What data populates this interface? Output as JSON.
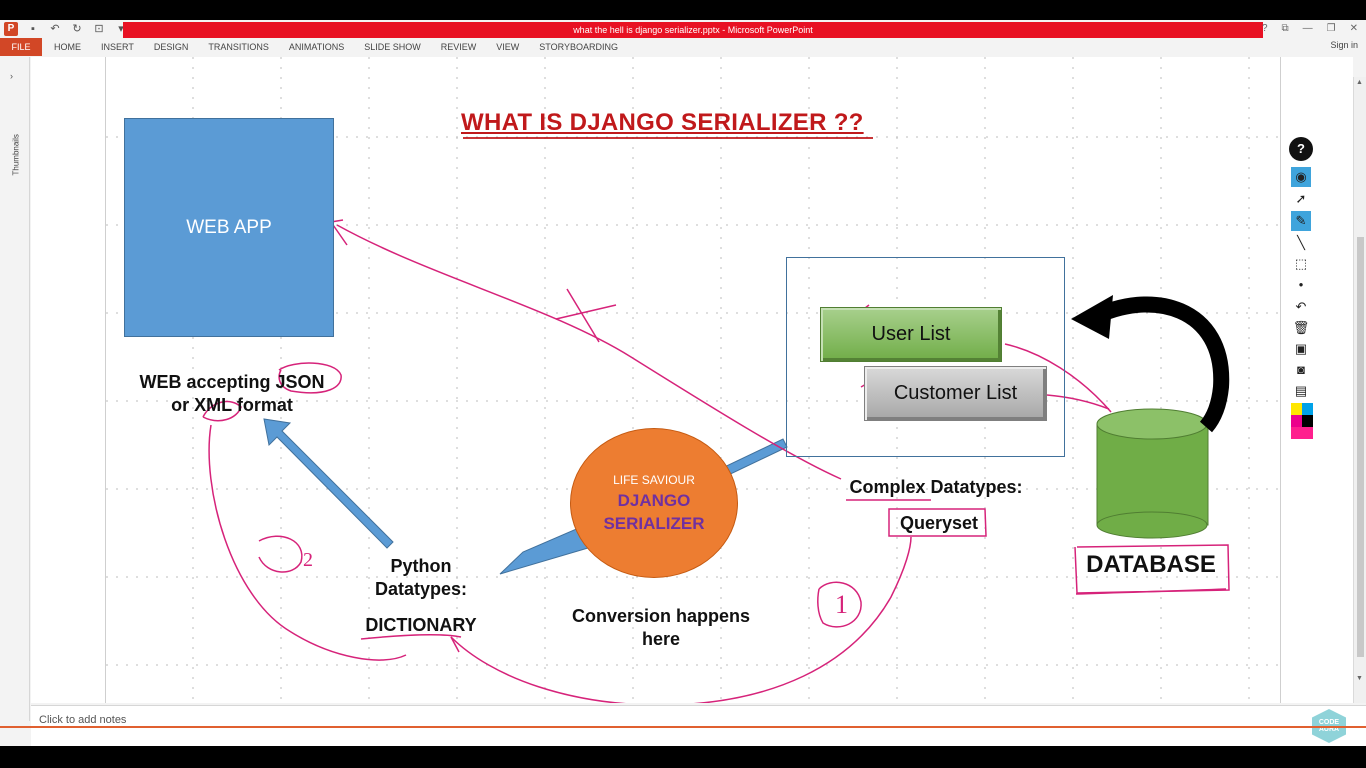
{
  "window": {
    "title": "what the hell is django serializer.pptx -  Microsoft PowerPoint",
    "controls": [
      "?",
      "⧉",
      "—",
      "❐",
      "✕"
    ],
    "sign_in": "Sign in"
  },
  "quick_access": {
    "icons": [
      "powerpoint-logo",
      "save-icon",
      "undo-icon",
      "redo-icon",
      "presenter-icon",
      "customize-icon"
    ]
  },
  "ribbon": {
    "file_tab": "FILE",
    "tabs": [
      "HOME",
      "INSERT",
      "DESIGN",
      "TRANSITIONS",
      "ANIMATIONS",
      "SLIDE SHOW",
      "REVIEW",
      "VIEW",
      "STORYBOARDING"
    ]
  },
  "thumbnails": {
    "label": "Thumbnails",
    "chevron": "›"
  },
  "slide": {
    "title": "WHAT IS DJANGO SERIALIZER ??",
    "web_app_label": "WEB APP",
    "web_caption_line1": "WEB accepting JSON",
    "web_caption_line2": "or XML format",
    "user_list": "User List",
    "customer_list": "Customer List",
    "complex_datatypes": "Complex Datatypes:",
    "queryset": "Queryset",
    "database": "DATABASE",
    "life_saviour": "LIFE SAVIOUR",
    "serializer_line1": "DJANGO",
    "serializer_line2": "SERIALIZER",
    "python_line1": "Python",
    "python_line2": "Datatypes:",
    "dictionary": "DICTIONARY",
    "conversion_line1": "Conversion happens",
    "conversion_line2": "here",
    "annotation_1": "1",
    "annotation_2": "2",
    "colors": {
      "title_red": "#c0191b",
      "web_app_blue": "#5b9bd5",
      "user_list_green": "#70ad47",
      "customer_list_gray": "#a6a6a6",
      "serializer_orange": "#ed7d31",
      "serializer_text_purple": "#7030a0",
      "database_green": "#70ad47",
      "ink_magenta": "#d6237a"
    }
  },
  "notes": {
    "placeholder": "Click to add notes"
  },
  "logo_badge": {
    "line1": "CODE",
    "line2": "AURA"
  },
  "pen_toolbar": {
    "tools": [
      "help-icon",
      "eye-icon",
      "select-arrow-icon",
      "highlighter-icon",
      "pen-icon",
      "eraser-icon",
      "dot-icon",
      "undo-icon",
      "trash-icon",
      "screenshot-icon",
      "camera-icon",
      "clipboard-icon"
    ],
    "swatches": [
      "#ffe600",
      "#00a2e8",
      "#ec008c",
      "#000000",
      "#ff1f8e",
      "#ffffff"
    ]
  }
}
